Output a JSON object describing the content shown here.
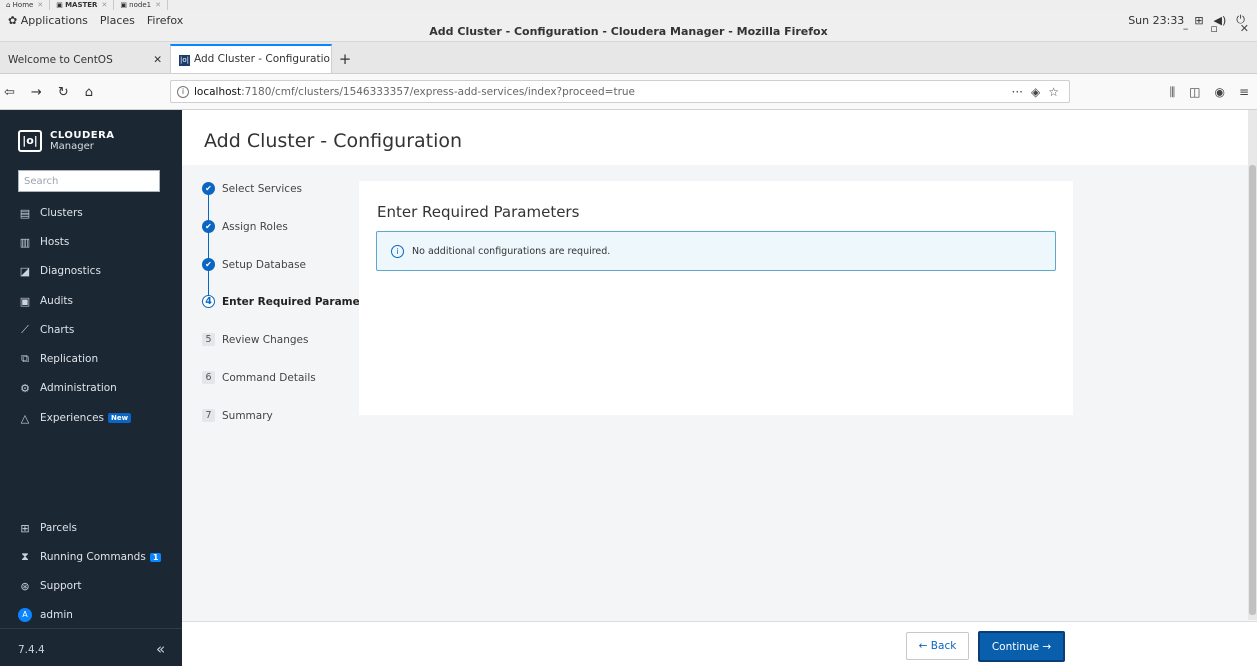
{
  "vm_tabs": [
    {
      "label": "Home",
      "bold": false
    },
    {
      "label": "MASTER",
      "bold": true
    },
    {
      "label": "node1",
      "bold": false
    }
  ],
  "gnome": {
    "applications": "Applications",
    "places": "Places",
    "firefox": "Firefox",
    "clock": "Sun 23:33"
  },
  "window": {
    "title": "Add Cluster - Configuration - Cloudera Manager - Mozilla Firefox"
  },
  "browser": {
    "tabs": [
      {
        "label": "Welcome to CentOS"
      },
      {
        "label": "Add Cluster - Configuratio"
      }
    ],
    "url_host": "localhost",
    "url_rest": ":7180/cmf/clusters/1546333357/express-add-services/index?proceed=true"
  },
  "sidebar": {
    "brand_top": "CLOUDERA",
    "brand_bottom": "Manager",
    "search_placeholder": "Search",
    "items": [
      {
        "label": "Clusters",
        "icon": "clusters-icon"
      },
      {
        "label": "Hosts",
        "icon": "hosts-icon"
      },
      {
        "label": "Diagnostics",
        "icon": "diagnostics-icon"
      },
      {
        "label": "Audits",
        "icon": "audits-icon"
      },
      {
        "label": "Charts",
        "icon": "charts-icon"
      },
      {
        "label": "Replication",
        "icon": "replication-icon"
      },
      {
        "label": "Administration",
        "icon": "gear-icon"
      },
      {
        "label": "Experiences",
        "icon": "experiences-icon",
        "badge": "New"
      }
    ],
    "bottom_items": [
      {
        "label": "Parcels",
        "icon": "parcels-icon"
      },
      {
        "label": "Running Commands",
        "icon": "hourglass-icon",
        "badge": "1"
      },
      {
        "label": "Support",
        "icon": "support-icon"
      },
      {
        "label": "admin",
        "icon": "avatar",
        "avatar_letter": "A"
      }
    ],
    "version": "7.4.4"
  },
  "main": {
    "title": "Add Cluster - Configuration",
    "steps": [
      {
        "label": "Select Services",
        "status": "done"
      },
      {
        "label": "Assign Roles",
        "status": "done"
      },
      {
        "label": "Setup Database",
        "status": "done"
      },
      {
        "label": "Enter Required Parameters",
        "status": "current",
        "number": "4"
      },
      {
        "label": "Review Changes",
        "status": "pending",
        "number": "5"
      },
      {
        "label": "Command Details",
        "status": "pending",
        "number": "6"
      },
      {
        "label": "Summary",
        "status": "pending",
        "number": "7"
      }
    ],
    "panel_heading": "Enter Required Parameters",
    "alert_text": "No additional configurations are required."
  },
  "footer": {
    "back_label": "← Back",
    "continue_label": "Continue →"
  },
  "colors": {
    "sidebar_bg": "#1b2733",
    "accent": "#0a66c2",
    "continue_bg": "#0a5fad"
  }
}
